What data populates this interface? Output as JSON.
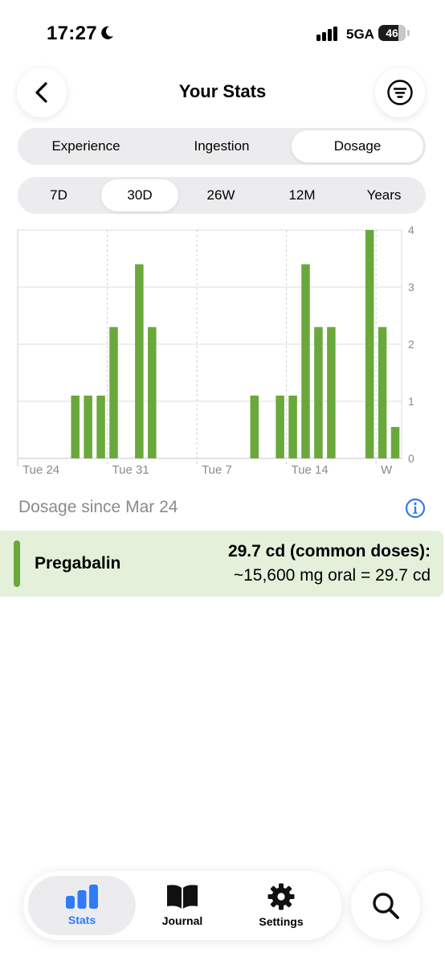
{
  "status_bar": {
    "time": "17:27",
    "network": "5GA",
    "battery": "46"
  },
  "header": {
    "title": "Your Stats"
  },
  "tabs_primary": [
    {
      "label": "Experience",
      "active": false
    },
    {
      "label": "Ingestion",
      "active": false
    },
    {
      "label": "Dosage",
      "active": true
    }
  ],
  "tabs_range": [
    {
      "label": "7D",
      "active": false
    },
    {
      "label": "30D",
      "active": true
    },
    {
      "label": "26W",
      "active": false
    },
    {
      "label": "12M",
      "active": false
    },
    {
      "label": "Years",
      "active": false
    }
  ],
  "chart_data": {
    "type": "bar",
    "x_tick_labels": [
      "Tue 24",
      "Tue 31",
      "Tue 7",
      "Tue 14",
      "W"
    ],
    "y_ticks": [
      0,
      1,
      2,
      3,
      4
    ],
    "ylim": [
      0,
      4
    ],
    "grid": true,
    "color": "#6aa83c",
    "series": [
      {
        "day_index": [
          4,
          5,
          6,
          7,
          9,
          10,
          18,
          20,
          21,
          22,
          23,
          24,
          27,
          28,
          29
        ],
        "values": [
          1.1,
          1.1,
          1.1,
          2.3,
          3.4,
          2.3,
          1.1,
          1.1,
          1.1,
          3.4,
          2.3,
          2.3,
          4.0,
          2.3,
          0.55
        ]
      }
    ]
  },
  "summary": {
    "since_label": "Dosage since Mar 24",
    "items": [
      {
        "name": "Pregabalin",
        "line1": "29.7 cd (common doses):",
        "line2": "~15,600 mg oral = 29.7 cd",
        "color": "#6aa83c"
      }
    ]
  },
  "bottom_nav": [
    {
      "label": "Stats",
      "icon": "bar-chart-icon",
      "active": true
    },
    {
      "label": "Journal",
      "icon": "book-icon",
      "active": false
    },
    {
      "label": "Settings",
      "icon": "gear-icon",
      "active": false
    }
  ],
  "colors": {
    "accent": "#2f7cf6",
    "bar": "#6aa83c",
    "row_bg": "#e4f0da"
  }
}
